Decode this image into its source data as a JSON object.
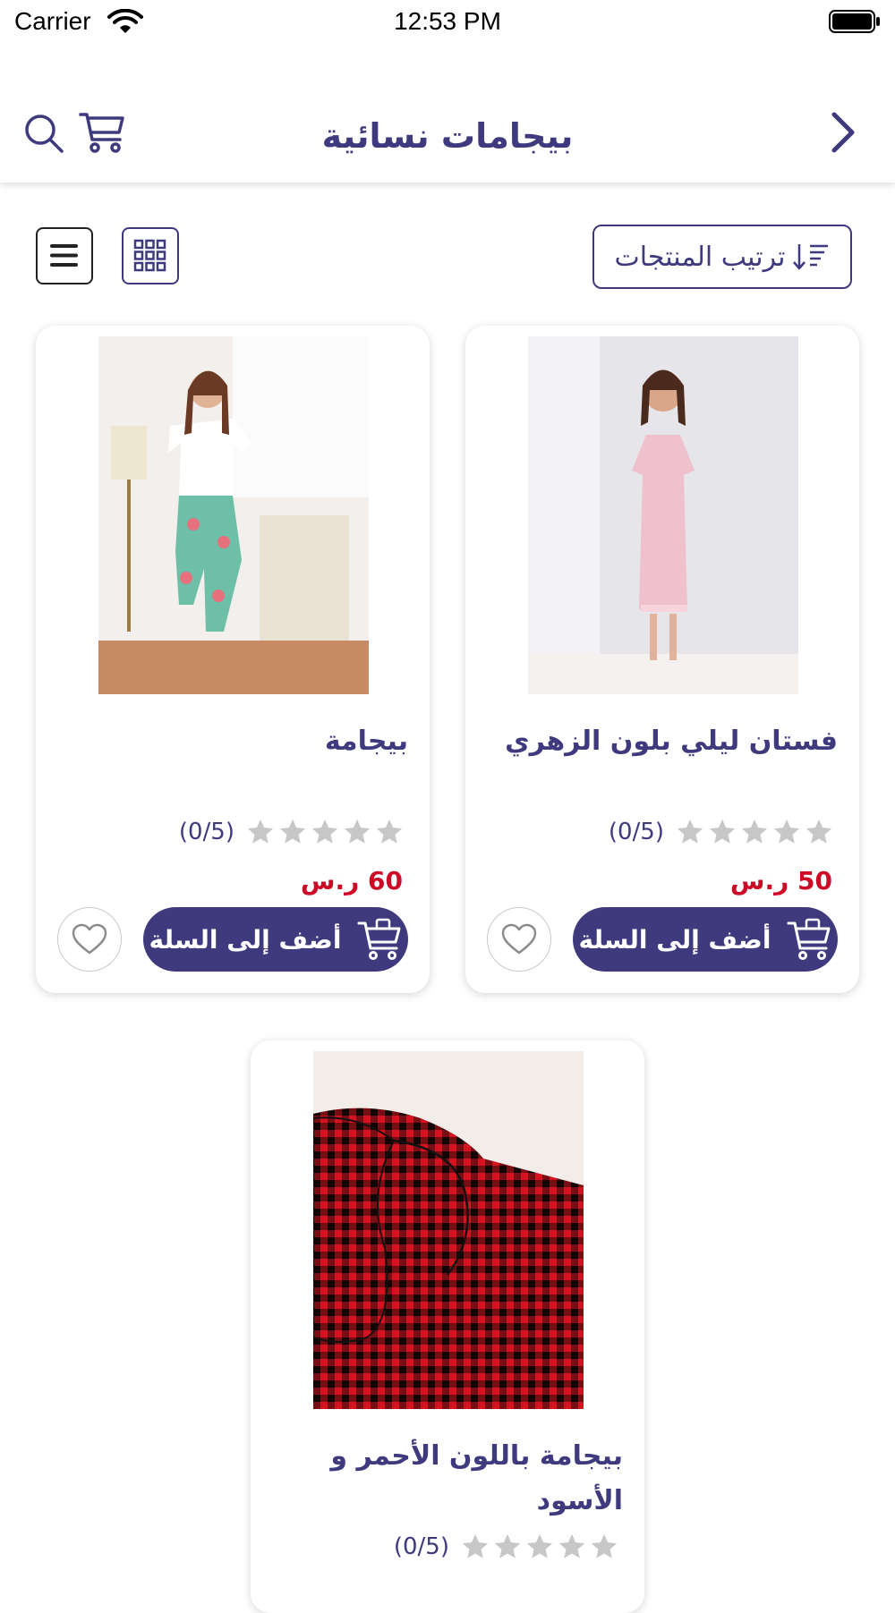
{
  "status_bar": {
    "carrier": "Carrier",
    "time": "12:53 PM"
  },
  "header": {
    "title": "بيجامات نسائية"
  },
  "toolbar": {
    "sort_label": "ترتيب المنتجات"
  },
  "products": [
    {
      "name": "فستان ليلي بلون الزهري",
      "rating": "(0/5)",
      "price": "50 ر.س",
      "add_label": "أضف إلى السلة"
    },
    {
      "name": "بيجامة",
      "rating": "(0/5)",
      "price": "60 ر.س",
      "add_label": "أضف إلى السلة"
    },
    {
      "name": "بيجامة باللون الأحمر و الأسود",
      "rating": "(0/5)",
      "price": "",
      "add_label": ""
    }
  ],
  "colors": {
    "brand": "#3f3a7e",
    "price": "#cc0a26",
    "star": "#c7c7c7"
  }
}
